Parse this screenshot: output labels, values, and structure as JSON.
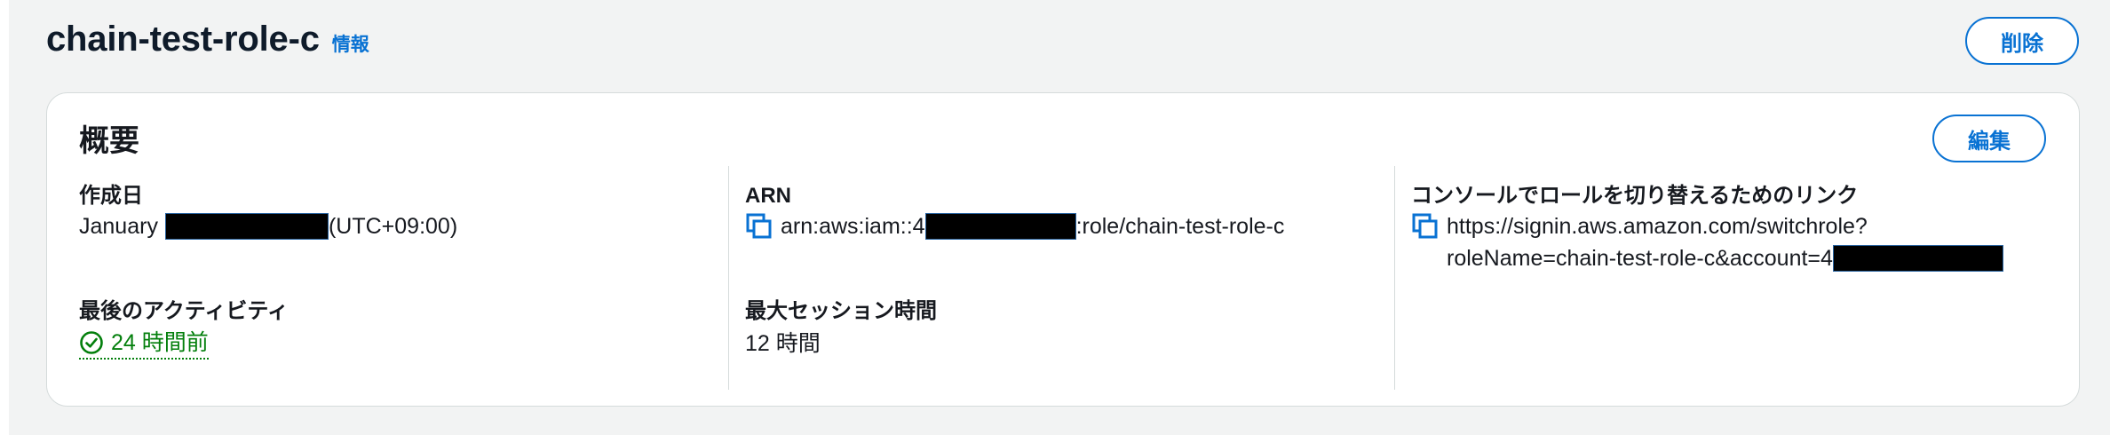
{
  "header": {
    "title": "chain-test-role-c",
    "info_link": "情報",
    "delete_label": "削除"
  },
  "summary": {
    "title": "概要",
    "edit_label": "編集",
    "created": {
      "label": "作成日",
      "prefix": "January",
      "suffix": "(UTC+09:00)"
    },
    "last_activity": {
      "label": "最後のアクティビティ",
      "value": "24 時間前",
      "icon": "check-circle-icon",
      "color": "#037f0c"
    },
    "arn": {
      "label": "ARN",
      "prefix": "arn:aws:iam::4",
      "suffix": ":role/chain-test-role-c"
    },
    "max_session": {
      "label": "最大セッション時間",
      "value": "12 時間"
    },
    "switch_link": {
      "label": "コンソールでロールを切り替えるためのリンク",
      "line1": "https://signin.aws.amazon.com/switchrole?",
      "line2": "roleName=chain-test-role-c&account=4"
    }
  },
  "colors": {
    "accent": "#0972d3",
    "success": "#037f0c",
    "background": "#f2f3f3",
    "redaction": "#000000"
  }
}
